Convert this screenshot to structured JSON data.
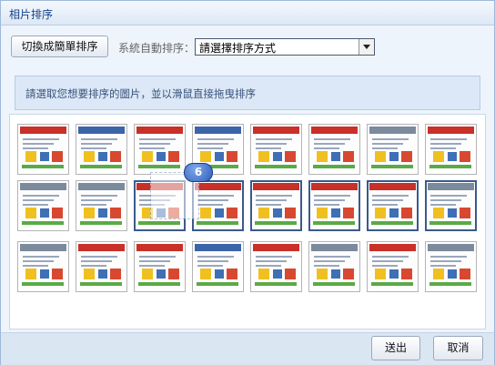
{
  "dialog": {
    "title": "相片排序"
  },
  "toolbar": {
    "toggle_button": "切換成簡單排序",
    "auto_sort_label": "系統自動排序：",
    "sort_select_value": "請選擇排序方式"
  },
  "info": {
    "text": "請選取您想要排序的圖片，並以滑鼠直接拖曳排序"
  },
  "drag": {
    "position_badge": "6"
  },
  "footer": {
    "send_button": "送出",
    "cancel_button": "取消"
  },
  "thumbs": [
    {
      "style": "red",
      "selected": false
    },
    {
      "style": "blue",
      "selected": false
    },
    {
      "style": "red",
      "selected": false
    },
    {
      "style": "blue",
      "selected": false
    },
    {
      "style": "red",
      "selected": false
    },
    {
      "style": "red",
      "selected": false
    },
    {
      "style": "gray",
      "selected": false
    },
    {
      "style": "red",
      "selected": false
    },
    {
      "style": "gray",
      "selected": false
    },
    {
      "style": "gray",
      "selected": false
    },
    {
      "style": "red",
      "selected": true
    },
    {
      "style": "red",
      "selected": true
    },
    {
      "style": "red",
      "selected": true
    },
    {
      "style": "red",
      "selected": true
    },
    {
      "style": "red",
      "selected": true
    },
    {
      "style": "gray",
      "selected": true
    },
    {
      "style": "gray",
      "selected": false
    },
    {
      "style": "red",
      "selected": false
    },
    {
      "style": "red",
      "selected": false
    },
    {
      "style": "blue",
      "selected": false
    },
    {
      "style": "red",
      "selected": false
    },
    {
      "style": "gray",
      "selected": false
    },
    {
      "style": "red",
      "selected": false
    },
    {
      "style": "gray",
      "selected": false
    }
  ]
}
